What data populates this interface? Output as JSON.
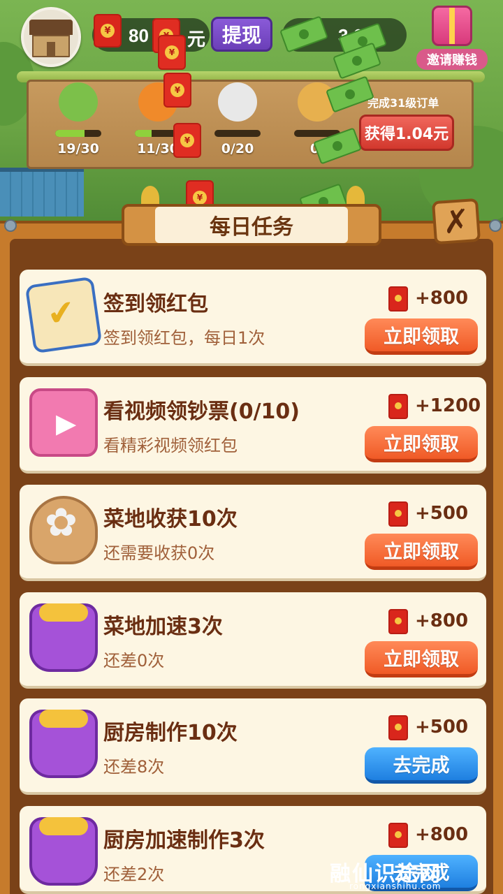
{
  "header": {
    "money_value": "80",
    "money_unit": "元",
    "withdraw_label": "提现",
    "cash_value": "3 6",
    "invite_label": "邀请赚钱"
  },
  "orders": {
    "items": [
      {
        "name": "cucumber",
        "count": "19/30",
        "progress": 0.63
      },
      {
        "name": "pumpkin",
        "count": "11/30",
        "progress": 0.37
      },
      {
        "name": "buns",
        "count": "0/20",
        "progress": 0
      },
      {
        "name": "pastry",
        "count": "0/",
        "progress": 0
      }
    ],
    "target_label": "完成31级订单",
    "claim_label": "获得1.04元"
  },
  "panel": {
    "title": "每日任务",
    "close_label": "✗"
  },
  "tasks": [
    {
      "icon": "calendar-check-icon",
      "title": "签到领红包",
      "desc": "签到领红包，每日1次",
      "reward": "+800",
      "button": "立即领取",
      "button_style": "red"
    },
    {
      "icon": "tv-play-icon",
      "title": "看视频领钞票(0/10)",
      "desc": "看精彩视频领红包",
      "reward": "+1200",
      "button": "立即领取",
      "button_style": "red"
    },
    {
      "icon": "flower-basket-icon",
      "title": "菜地收获10次",
      "desc": "还需要收获0次",
      "reward": "+500",
      "button": "立即领取",
      "button_style": "red"
    },
    {
      "icon": "gift-box-icon",
      "title": "菜地加速3次",
      "desc": "还差0次",
      "reward": "+800",
      "button": "立即领取",
      "button_style": "red"
    },
    {
      "icon": "gift-box-icon",
      "title": "厨房制作10次",
      "desc": "还差8次",
      "reward": "+500",
      "button": "去完成",
      "button_style": "blue"
    },
    {
      "icon": "gift-box-icon",
      "title": "厨房加速制作3次",
      "desc": "还差2次",
      "reward": "+800",
      "button": "去完成",
      "button_style": "blue"
    }
  ],
  "watermark": {
    "text": "融仙识途网",
    "url": "rongxianshihu.com"
  },
  "colors": {
    "button_red": "#f05a26",
    "button_blue": "#1e7fe0",
    "title_text": "#6a2e12",
    "panel_wood": "#c67b2c"
  }
}
